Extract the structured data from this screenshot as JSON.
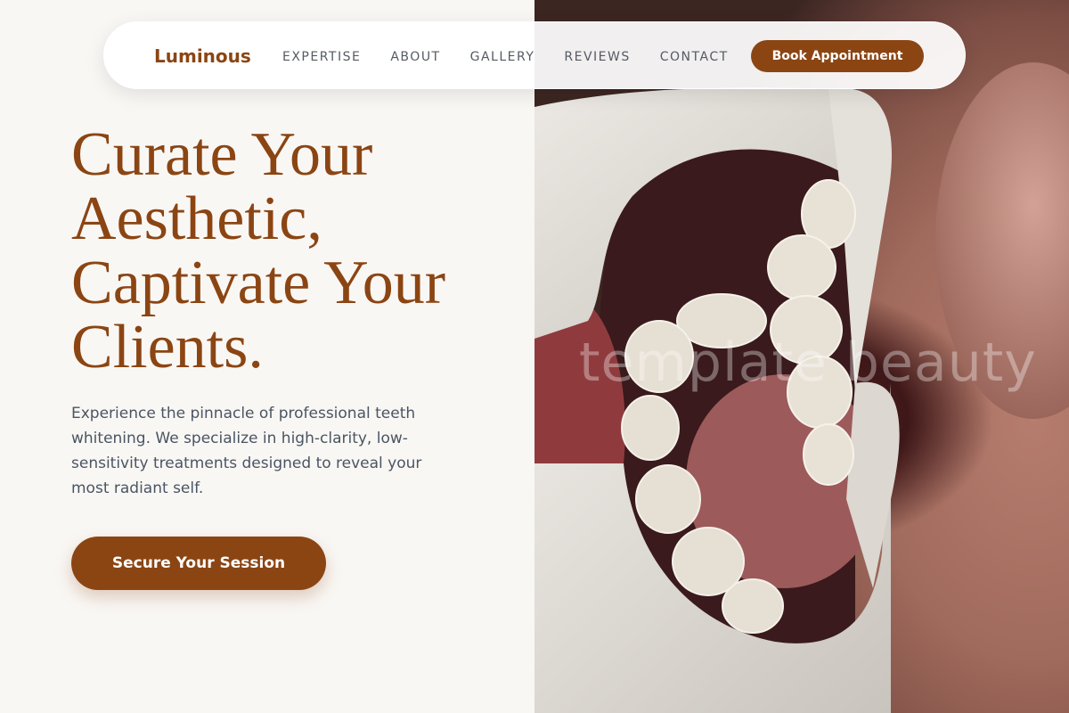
{
  "brand": {
    "name": "Luminous"
  },
  "nav": {
    "links": [
      "EXPERTISE",
      "ABOUT",
      "GALLERY",
      "REVIEWS",
      "CONTACT"
    ],
    "book_button": "Book Appointment"
  },
  "hero": {
    "headline": "Curate Your Aesthetic, Captivate Your Clients.",
    "description": "Experience the pinnacle of professional teeth whitening. We specialize in high-clarity, low-sensitivity treatments designed to reveal your most radiant self.",
    "cta": "Secure Your Session",
    "watermark": "template beauty"
  },
  "colors": {
    "accent": "#8b4513",
    "background": "#f9f7f4",
    "body_text": "#4a5563"
  }
}
